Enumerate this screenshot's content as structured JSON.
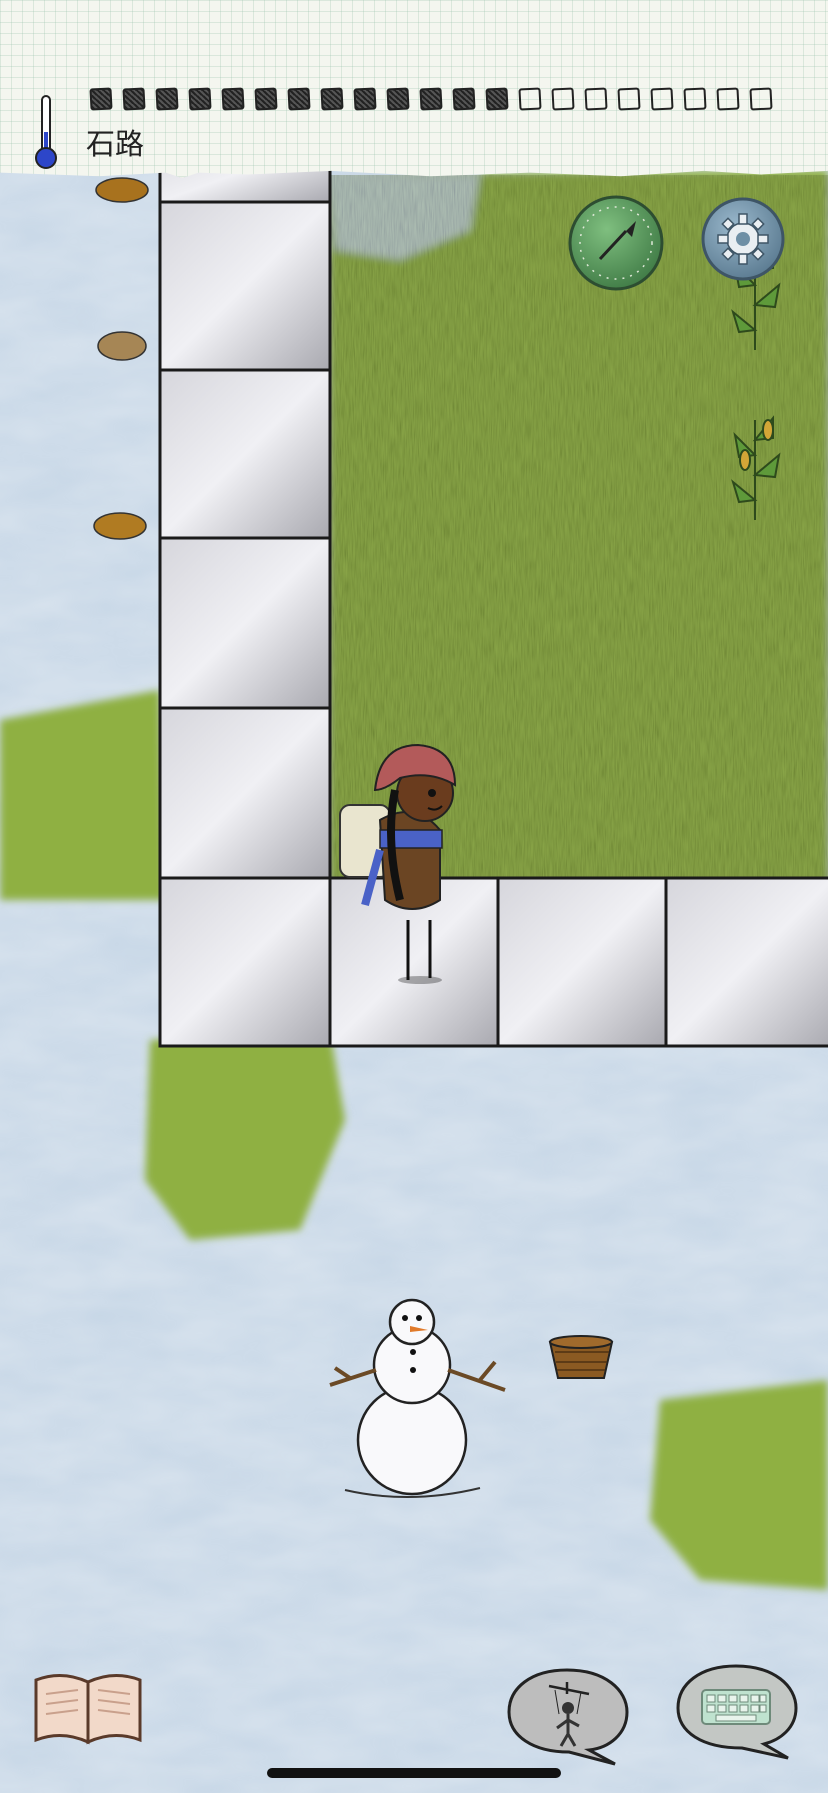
{
  "hud": {
    "location_label": "石路",
    "food_meter": {
      "filled": 13,
      "total": 21
    }
  },
  "icons": {
    "thermometer": "thermometer-icon",
    "compass": "compass-icon",
    "settings": "gear-icon",
    "recipe_book": "book-icon",
    "emote": "puppet-emote-icon",
    "keyboard": "keyboard-icon"
  },
  "colors": {
    "snow": "#c9d8e6",
    "grass": "#8fae3e",
    "stone": "#b7b7bd",
    "compass_green": "#4e8a52",
    "settings_blue": "#6e8fa5",
    "thermometer_blue": "#2d46c9"
  }
}
